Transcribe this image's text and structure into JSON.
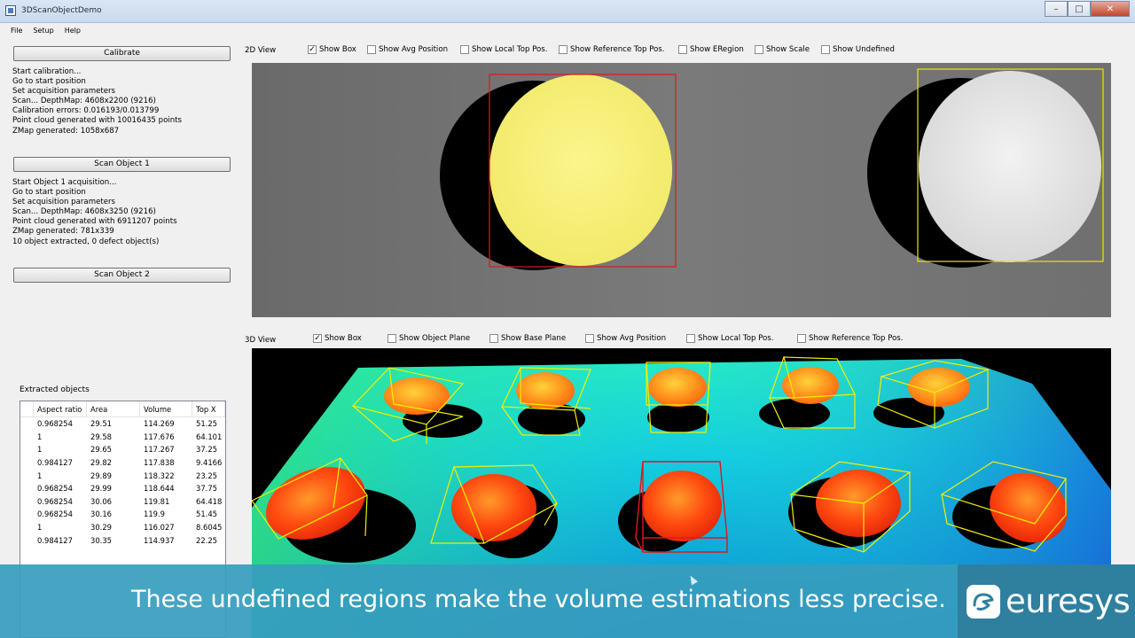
{
  "window": {
    "title": "3DScanObjectDemo"
  },
  "menu": [
    "File",
    "Setup",
    "Help"
  ],
  "left": {
    "calibrate_label": "Calibrate",
    "calibrate_log": "Start calibration...\nGo to start position\nSet acquisition parameters\nScan... DepthMap: 4608x2200 (9216)\nCalibration errors: 0.016193/0.013799\nPoint cloud generated with 10016435 points\nZMap generated: 1058x687",
    "scan1_label": "Scan Object 1",
    "scan1_log": "Start Object 1 acquisition...\nGo to start position\nSet acquisition parameters\nScan... DepthMap: 4608x3250 (9216)\nPoint cloud generated with 6911207 points\nZMap generated: 781x339\n10 object extracted, 0 defect object(s)",
    "scan2_label": "Scan Object 2",
    "objects_label": "Extracted objects",
    "table": {
      "headers": [
        "Aspect ratio",
        "Area",
        "Volume",
        "Top X"
      ],
      "rows": [
        [
          "0.968254",
          "29.51",
          "114.269",
          "51.25"
        ],
        [
          "1",
          "29.58",
          "117.676",
          "64.101"
        ],
        [
          "1",
          "29.65",
          "117.267",
          "37.25"
        ],
        [
          "0.984127",
          "29.82",
          "117.838",
          "9.4166"
        ],
        [
          "1",
          "29.89",
          "118.322",
          "23.25"
        ],
        [
          "0.968254",
          "29.99",
          "118.644",
          "37.75"
        ],
        [
          "0.968254",
          "30.06",
          "119.81",
          "64.418"
        ],
        [
          "0.968254",
          "30.16",
          "119.9",
          "51.45"
        ],
        [
          "1",
          "30.29",
          "116.027",
          "8.6045"
        ],
        [
          "0.984127",
          "30.35",
          "114.937",
          "22.25"
        ]
      ]
    }
  },
  "view2d": {
    "title": "2D View",
    "options": [
      {
        "label": "Show Box",
        "checked": true
      },
      {
        "label": "Show Avg Position",
        "checked": false
      },
      {
        "label": "Show Local Top Pos.",
        "checked": false
      },
      {
        "label": "Show Reference Top Pos.",
        "checked": false
      },
      {
        "label": "Show ERegion",
        "checked": false
      },
      {
        "label": "Show Scale",
        "checked": false
      },
      {
        "label": "Show Undefined",
        "checked": false
      }
    ]
  },
  "view3d": {
    "title": "3D View",
    "options": [
      {
        "label": "Show Box",
        "checked": true
      },
      {
        "label": "Show Object Plane",
        "checked": false
      },
      {
        "label": "Show Base Plane",
        "checked": false
      },
      {
        "label": "Show Avg Position",
        "checked": false
      },
      {
        "label": "Show Local Top Pos.",
        "checked": false
      },
      {
        "label": "Show Reference Top Pos.",
        "checked": false
      }
    ]
  },
  "caption": "These undefined regions make the volume estimations less precise.",
  "brand": "euresys",
  "colors": {
    "caption_bg": "#369dbe",
    "brand_bg": "#2f7f9e",
    "box_selected": "#e01818",
    "box_normal": "#e8e800",
    "yellow_object": "#f5f07a"
  }
}
